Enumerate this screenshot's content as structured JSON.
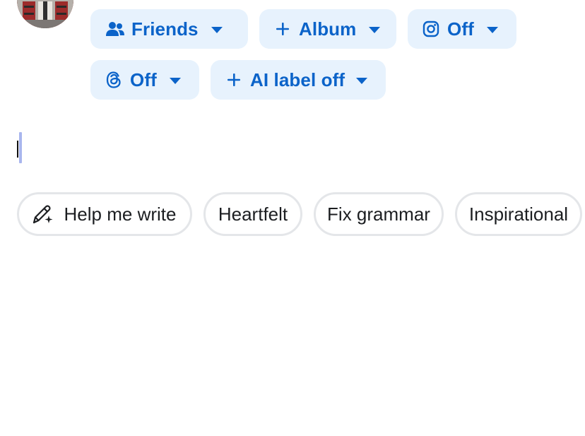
{
  "audience": {
    "friends_label": "Friends",
    "album_label": "Album",
    "instagram_label": "Off",
    "threads_label": "Off",
    "ai_label": "AI label off"
  },
  "colors": {
    "pill_bg": "#e7f2fd",
    "pill_text": "#0b63c9",
    "chip_border": "#e4e6e9",
    "chip_text": "#1c1e21",
    "selection": "#a9b6ee"
  },
  "icons": {
    "friends": "people-icon",
    "album": "plus-icon",
    "instagram": "instagram-icon",
    "threads": "threads-icon",
    "ai_label": "plus-icon",
    "help": "pencil-sparkle-icon"
  },
  "suggestions": {
    "help_label": "Help me write",
    "heartfelt_label": "Heartfelt",
    "grammar_label": "Fix grammar",
    "inspirational_label": "Inspirational"
  }
}
